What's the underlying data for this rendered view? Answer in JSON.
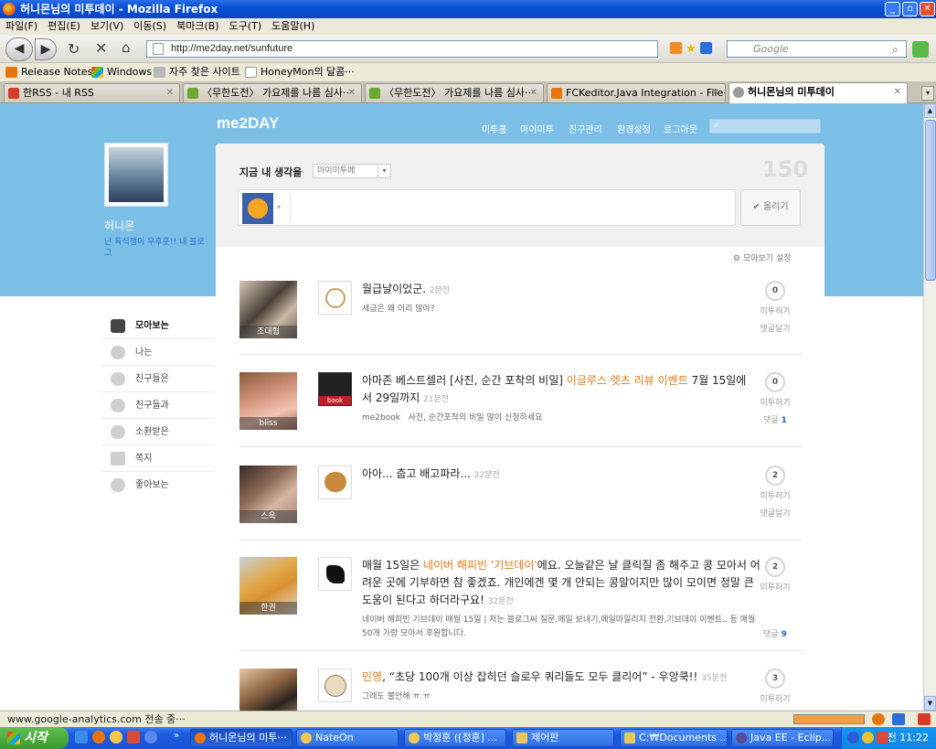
{
  "window": {
    "title": "허니몬님의 미투데이 - Mozilla Firefox"
  },
  "menubar": [
    "파일(F)",
    "편집(E)",
    "보기(V)",
    "이동(S)",
    "북마크(B)",
    "도구(T)",
    "도움말(H)"
  ],
  "nav": {
    "url": "http://me2day.net/sunfuture",
    "search_placeholder": "Google"
  },
  "bookmarks": [
    "Release Notes",
    "Windows",
    "자주 찾은 사이트",
    "HoneyMon의 달콤···"
  ],
  "tabs": [
    {
      "label": "한RSS - 내 RSS"
    },
    {
      "label": "〈무한도전〉 가요제를 나름 심사···"
    },
    {
      "label": "〈무한도전〉 가요제를 나름 심사···"
    },
    {
      "label": "FCKeditor.Java Integration - File···"
    },
    {
      "label": "허니몬님의 미투데이"
    }
  ],
  "site": {
    "logo": "me2DAY",
    "topnav": [
      "미투홈",
      "마이미투",
      "친구관리",
      "환경설정",
      "로그아웃"
    ]
  },
  "profile": {
    "name": "허니몬",
    "desc": "난 육식쟁이 우후훗!! 내 블로그"
  },
  "sidebar": [
    "모아보는",
    "나는",
    "친구들은",
    "친구들과",
    "소환받은",
    "쪽지",
    "좋아보는"
  ],
  "compose": {
    "prompt": "지금 내 생각을",
    "scope": "마이미투에",
    "counter": "150",
    "post_button": "올리기",
    "settings_link": "모아보기 설정"
  },
  "posts": [
    {
      "author": "조대협",
      "text": "월급날이었군.",
      "time": "2분전",
      "sub": "세금은 왜 이리 많아?",
      "metoo_count": "0",
      "metoo_label": "미투하기",
      "comment_label": "댓글달기",
      "comment_count": ""
    },
    {
      "author": "bliss",
      "text_pre": "아마존 베스트셀러 [사진, 순간 포착의 비밀] ",
      "text_hl": "이글루스 렛츠 리뷰 이벤트",
      "text_post": " 7월 15일에서 29일까지",
      "time": "21분전",
      "sub_src": "me2book",
      "sub": "사진, 순간포착의 비밀 많이 신청하세요",
      "metoo_count": "0",
      "metoo_label": "미투하기",
      "comment_label": "댓글",
      "comment_count": "1"
    },
    {
      "author": "스윽",
      "text": "아아... 춥고 배고파라...",
      "time": "22분전",
      "sub": "",
      "metoo_count": "2",
      "metoo_label": "미투하기",
      "comment_label": "댓글달기",
      "comment_count": ""
    },
    {
      "author": "한권",
      "text_pre": "매월 15일은 ",
      "text_hl": "네이버 해피빈 '기브데이'",
      "text_post": "에요. 오늘같은 날 클릭질 좀 해주고 콩 모아서 어려운 곳에 기부하면 참 좋겠죠. 개인에겐 몇 개 안되는 콩알이지만 많이 모이면 정말 큰 도움이 된다고 하더라구요!",
      "time": "32분전",
      "sub": "네이버 해피빈 기브데이 매월 15일 | 저는 블로그씨 질문,메일 보내기,메일마일리지 전환,기브데이 이벤트.. 등 매월 50개 가량 모아서 후원합니다.",
      "metoo_count": "2",
      "metoo_label": "미투하기",
      "comment_label": "댓글",
      "comment_count": "9"
    },
    {
      "author": "",
      "text_pre": "",
      "text_hl": "민영",
      "text_post": ", “초당 100개 이상 잡히던 슬로우 쿼리들도 모두 클리어” - 우앙쿡!!",
      "time": "35분전",
      "sub": "그래도 불안해 ㅠ.ㅠ",
      "metoo_count": "3",
      "metoo_label": "미투하기",
      "comment_label": "",
      "comment_count": ""
    }
  ],
  "statusbar": "www.google-analytics.com 전송 중···",
  "taskbar": {
    "start": "시작",
    "tasks": [
      "허니몬님의 미투···",
      "NateOn",
      "박정훈 ([정훈] ...",
      "제어판",
      "C:₩Documents ...",
      "Java EE - Eclip..."
    ],
    "clock": "오전 11:22"
  }
}
